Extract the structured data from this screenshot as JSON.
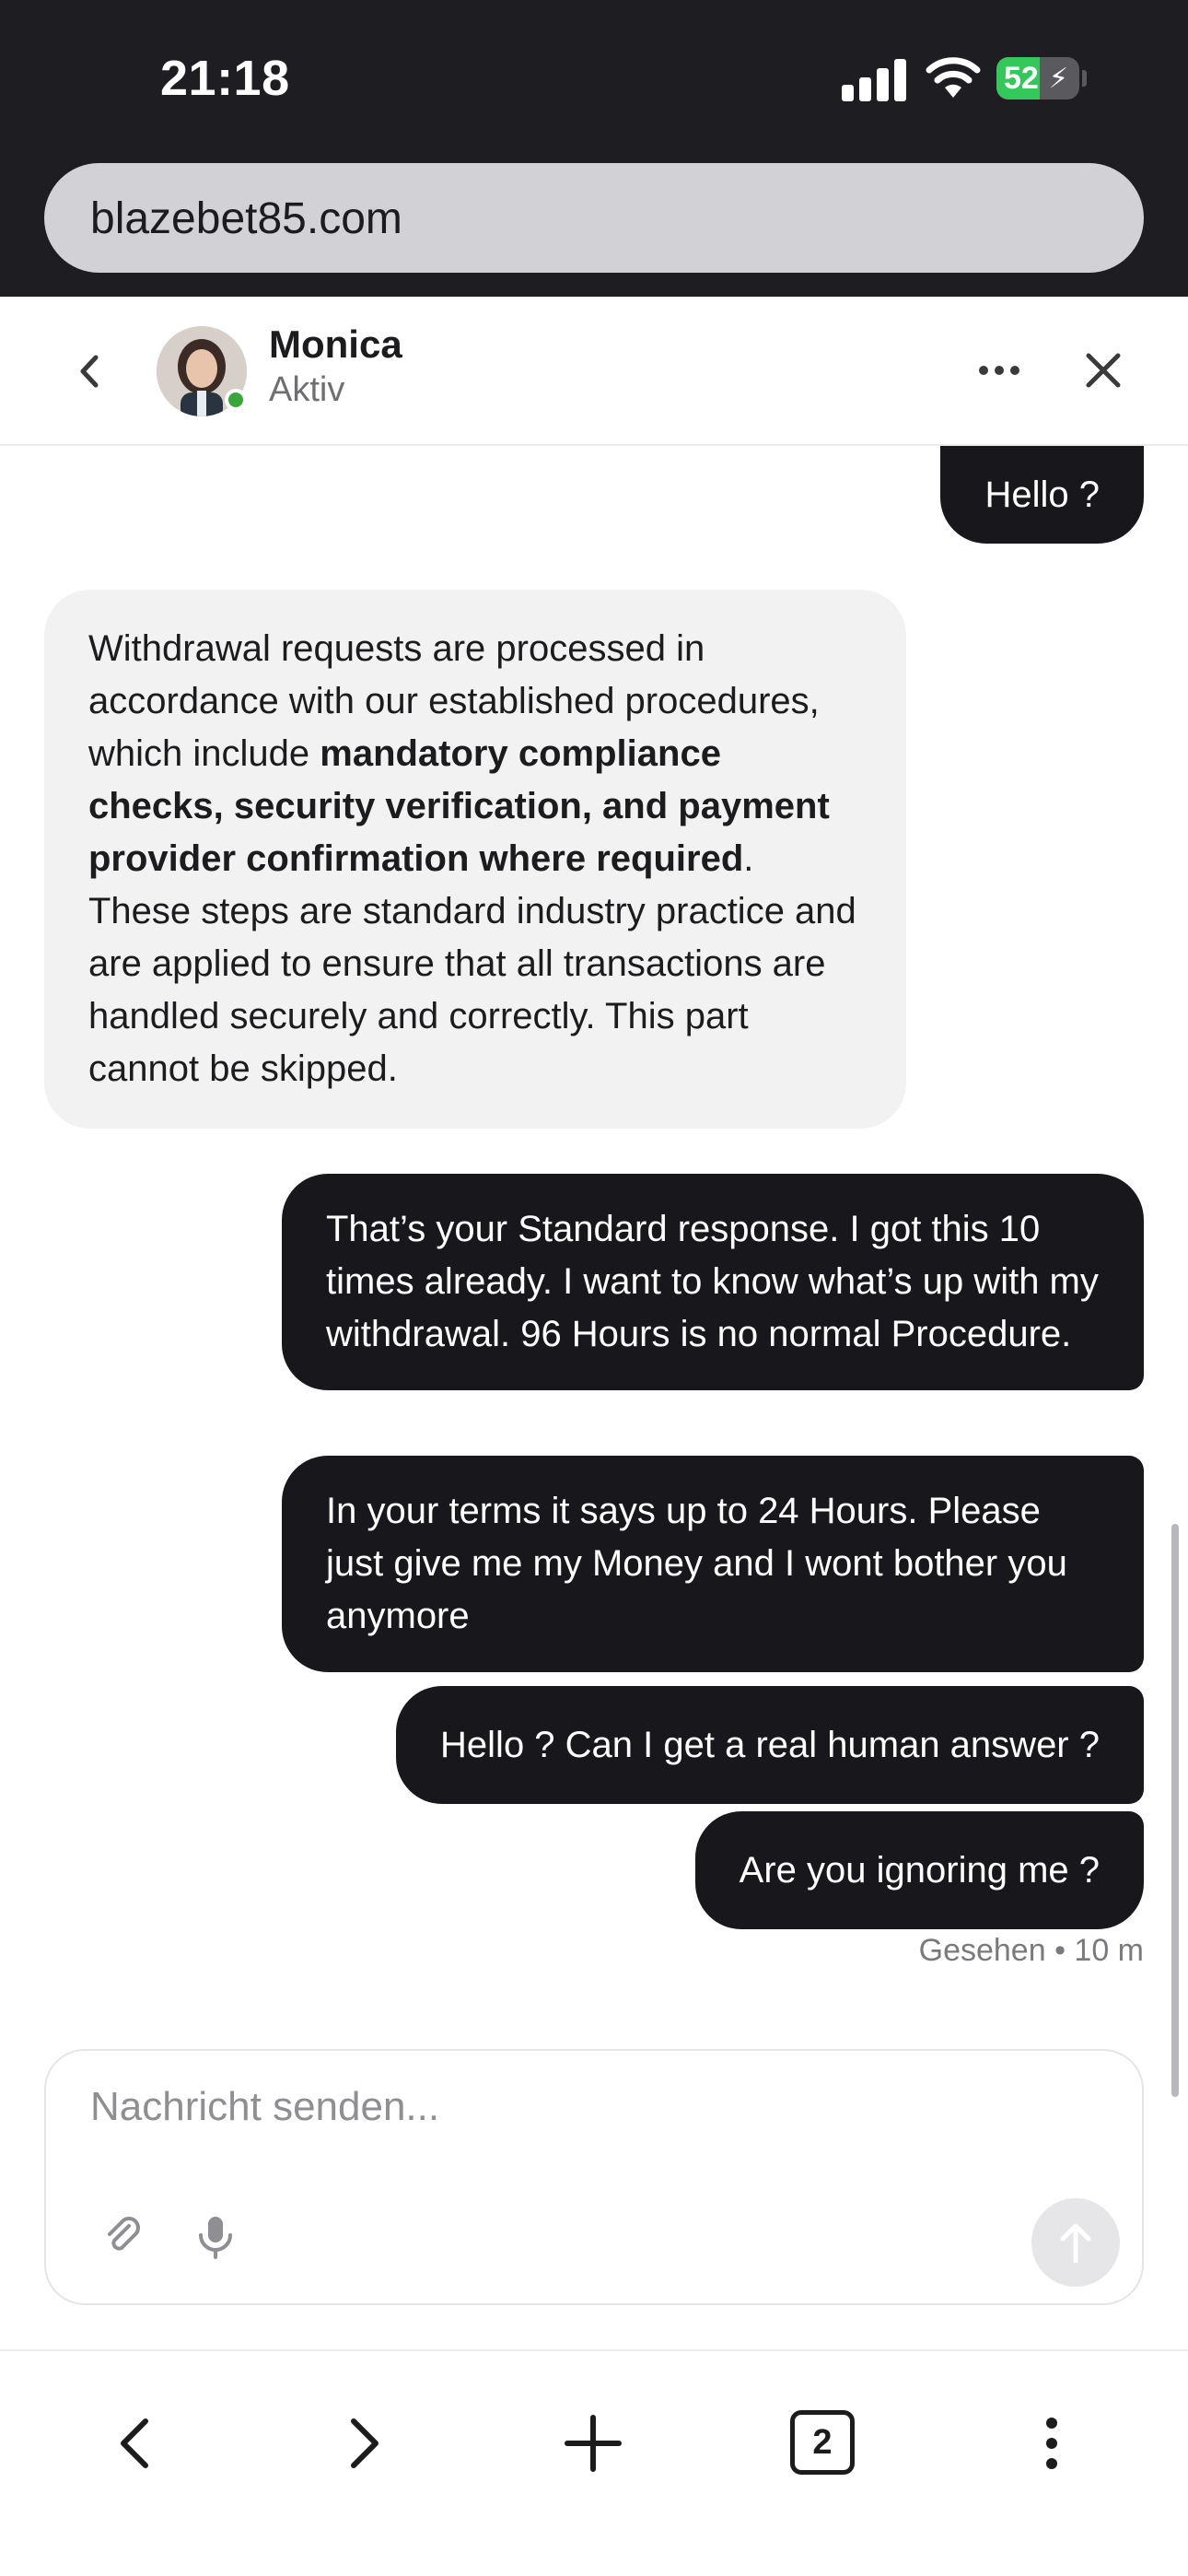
{
  "status_bar": {
    "time": "21:18",
    "battery": "52",
    "battery_level": 0.52
  },
  "browser": {
    "url": "blazebet85.com",
    "tab_count": "2"
  },
  "chat": {
    "agent_name": "Monica",
    "agent_status": "Aktiv",
    "messages": [
      {
        "from": "user",
        "text": "Hello ?"
      },
      {
        "from": "agent",
        "text_1": "Withdrawal requests are processed in accordance with our established procedures, which include ",
        "bold": "mandatory compliance checks, security verification, and payment provider confirmation where required",
        "text_2": ". These steps are standard industry practice and are applied to ensure that all transactions are handled securely and correctly. This part cannot be skipped."
      },
      {
        "from": "user",
        "text": "That’s your Standard response. I got this 10 times already. I want to know what’s up with my withdrawal. 96 Hours is no normal Procedure."
      },
      {
        "from": "user",
        "text": "In your terms it says up to 24 Hours. Please just give me my Money and I wont bother you anymore"
      },
      {
        "from": "user",
        "text": "Hello ? Can I get a real human answer ?"
      },
      {
        "from": "user",
        "text": "Are you ignoring me ?"
      }
    ],
    "seen_status": "Gesehen • 10 m"
  },
  "composer": {
    "placeholder": "Nachricht senden..."
  },
  "colors": {
    "user_bubble": "#18181c",
    "agent_bubble": "#f2f2f3",
    "online": "#3aa63a",
    "battery": "#34c759"
  }
}
